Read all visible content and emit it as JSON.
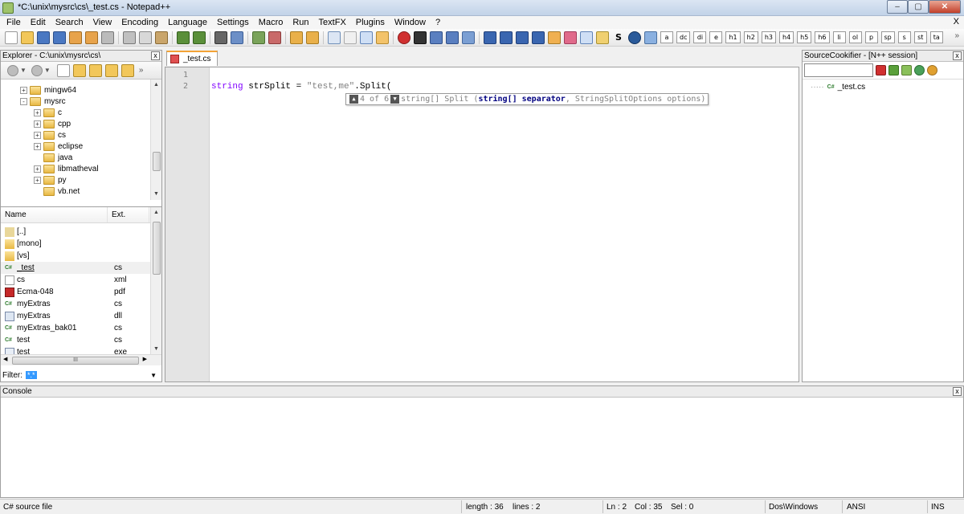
{
  "window": {
    "title": "*C:\\unix\\mysrc\\cs\\_test.cs - Notepad++",
    "minimize": "–",
    "maximize": "▢",
    "close": "✕"
  },
  "menu": {
    "items": [
      "File",
      "Edit",
      "Search",
      "View",
      "Encoding",
      "Language",
      "Settings",
      "Macro",
      "Run",
      "TextFX",
      "Plugins",
      "Window",
      "?"
    ],
    "close_x": "X"
  },
  "toolbar": {
    "text_buttons": [
      "S",
      "a",
      "dc",
      "di",
      "e",
      "h1",
      "h2",
      "h3",
      "h4",
      "h5",
      "h6",
      "li",
      "ol",
      "p",
      "sp",
      "s",
      "st",
      "ta"
    ],
    "overflow": "»"
  },
  "explorer": {
    "title": "Explorer - C:\\unix\\mysrc\\cs\\",
    "close": "x",
    "overflow": "»",
    "tree": [
      {
        "label": "mingw64",
        "level": 0
      },
      {
        "label": "mysrc",
        "level": 0
      },
      {
        "label": "c",
        "level": 1
      },
      {
        "label": "cpp",
        "level": 1
      },
      {
        "label": "cs",
        "level": 1
      },
      {
        "label": "eclipse",
        "level": 1
      },
      {
        "label": "java",
        "level": 1
      },
      {
        "label": "libmatheval",
        "level": 1
      },
      {
        "label": "py",
        "level": 1
      },
      {
        "label": "vb.net",
        "level": 1
      }
    ],
    "columns": {
      "name": "Name",
      "ext": "Ext."
    },
    "files": [
      {
        "name": "[..]",
        "ext": "",
        "icon": "up-folder-icon"
      },
      {
        "name": "[mono]",
        "ext": "",
        "icon": "folder-icon"
      },
      {
        "name": "[vs]",
        "ext": "",
        "icon": "folder-icon"
      },
      {
        "name": "_test",
        "ext": "cs",
        "icon": "csharp-file-icon"
      },
      {
        "name": "cs",
        "ext": "xml",
        "icon": "xml-file-icon"
      },
      {
        "name": "Ecma-048",
        "ext": "pdf",
        "icon": "pdf-file-icon"
      },
      {
        "name": "myExtras",
        "ext": "cs",
        "icon": "csharp-file-icon"
      },
      {
        "name": "myExtras",
        "ext": "dll",
        "icon": "dll-file-icon"
      },
      {
        "name": "myExtras_bak01",
        "ext": "cs",
        "icon": "csharp-file-icon"
      },
      {
        "name": "test",
        "ext": "cs",
        "icon": "csharp-file-icon"
      },
      {
        "name": "test",
        "ext": "exe",
        "icon": "exe-file-icon"
      }
    ],
    "hscroll_grip": "III",
    "filter_label": "Filter:",
    "filter_value": "*.*"
  },
  "editor": {
    "tab_label": "_test.cs",
    "line_numbers": [
      "1",
      "2"
    ],
    "code": {
      "keyword": "string",
      "ident": " strSplit = ",
      "string": "\"test,me\"",
      "rest": ".Split("
    },
    "calltip": {
      "counter": "4 of 6",
      "prefix": "string[] Split (",
      "highlight": "string[] separator",
      "suffix": ", StringSplitOptions options)"
    }
  },
  "sourcecookifier": {
    "title": "SourceCookifier - [N++ session]",
    "close": "x",
    "tree_item": "_test.cs",
    "tree_badge": "C#"
  },
  "console": {
    "title": "Console",
    "close": "x"
  },
  "statusbar": {
    "filetype": "C# source file",
    "length": "length : 36",
    "lines": "lines : 2",
    "ln": "Ln : 2",
    "col": "Col : 35",
    "sel": "Sel : 0",
    "eol": "Dos\\Windows",
    "encoding": "ANSI",
    "mode": "INS"
  }
}
